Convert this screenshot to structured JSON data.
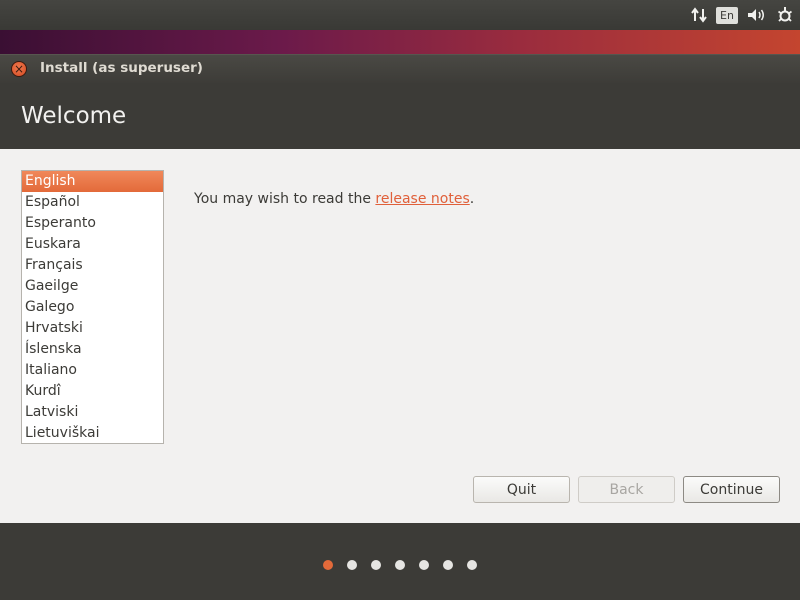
{
  "top_panel": {
    "icons": [
      "network-updown-icon",
      "keyboard-layout-icon",
      "volume-icon",
      "system-gear-icon"
    ],
    "keyboard_layout": "En"
  },
  "window": {
    "title": "Install (as superuser)",
    "page_title": "Welcome"
  },
  "languages": {
    "selected": "English",
    "items": [
      "English",
      "Español",
      "Esperanto",
      "Euskara",
      "Français",
      "Gaeilge",
      "Galego",
      "Hrvatski",
      "Íslenska",
      "Italiano",
      "Kurdî",
      "Latviski",
      "Lietuviškai"
    ]
  },
  "notes": {
    "prefix": "You may wish to read the ",
    "link": "release notes",
    "suffix": "."
  },
  "buttons": {
    "quit": "Quit",
    "back": "Back",
    "continue": "Continue"
  },
  "progress": {
    "total_steps": 7,
    "current_step": 1
  },
  "colors": {
    "accent": "#e36a3a",
    "link": "#e0603a",
    "panel": "#3c3b37",
    "content_bg": "#f2f1f0"
  }
}
